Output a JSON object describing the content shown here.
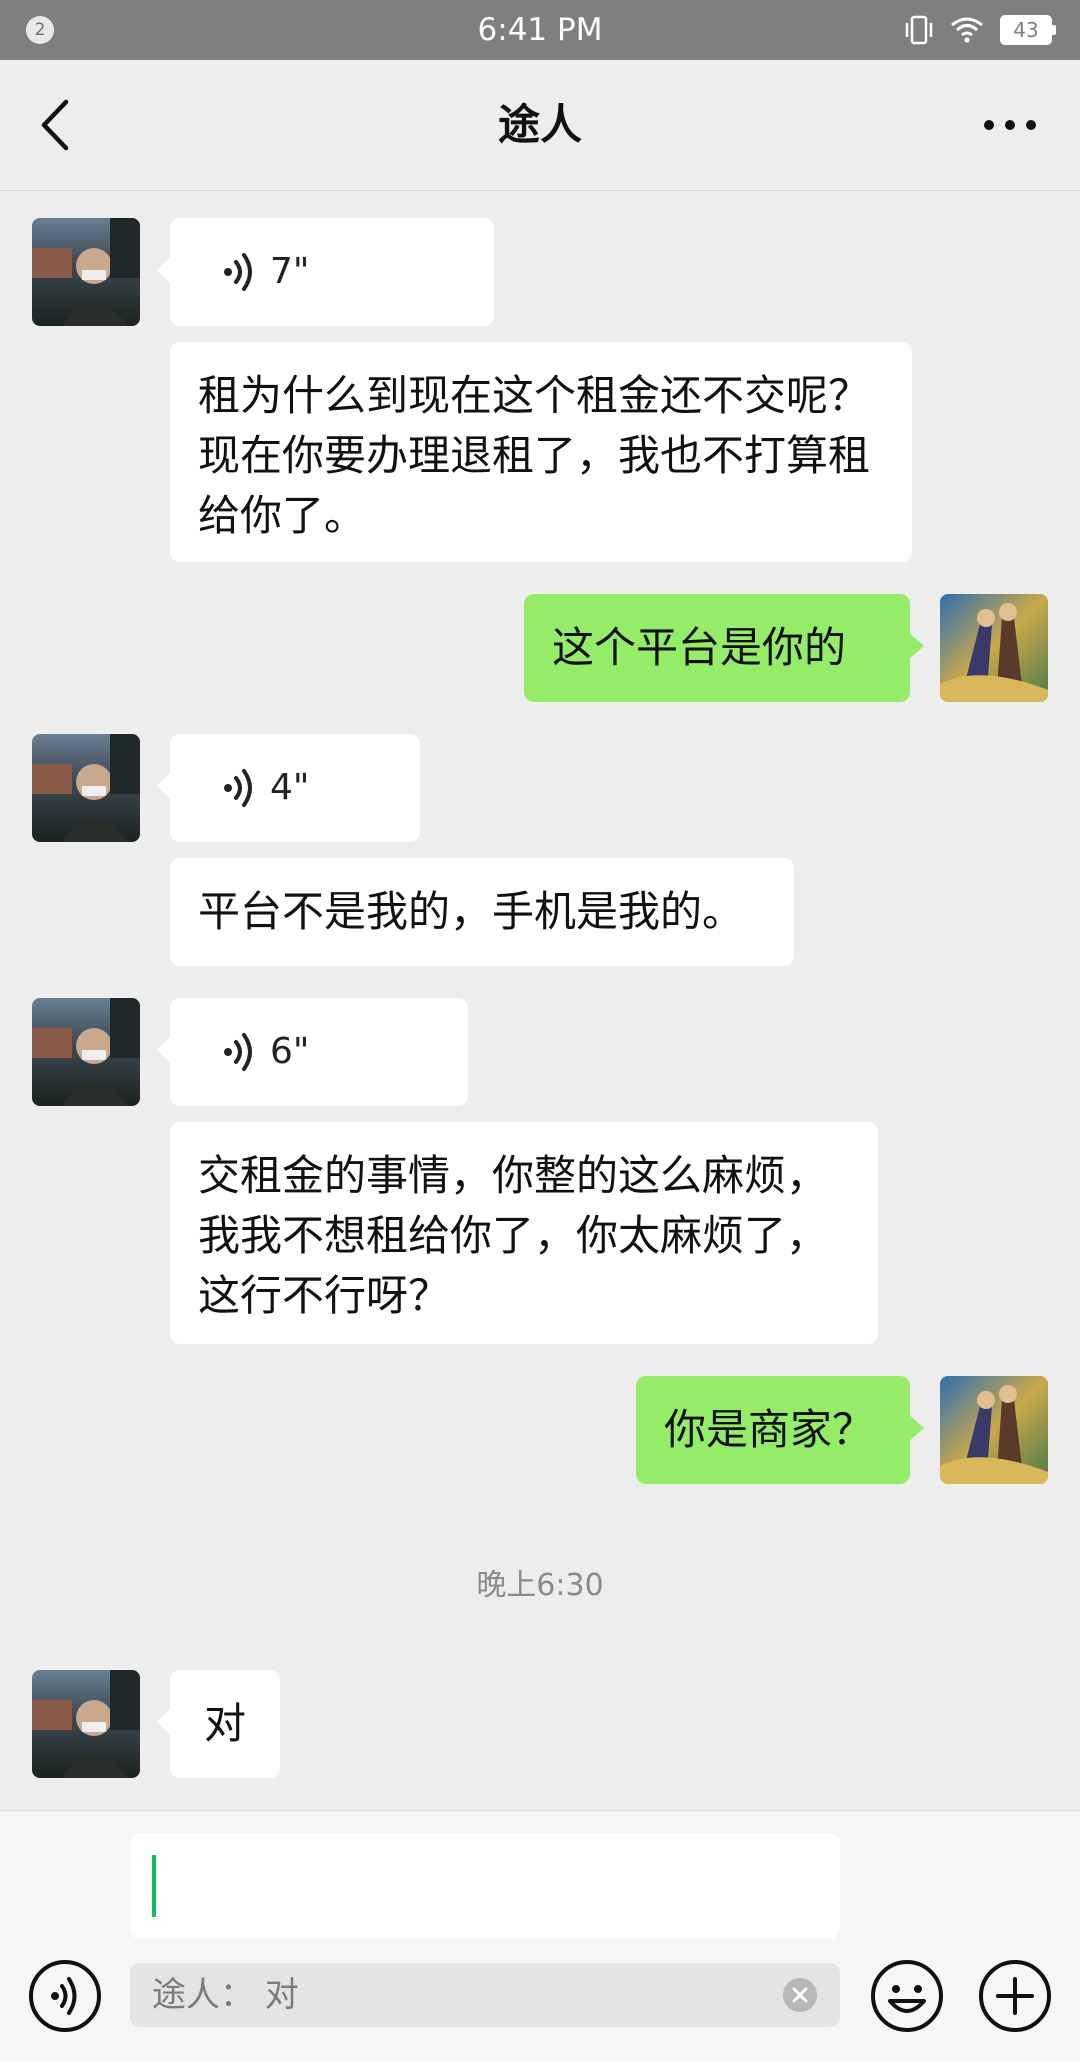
{
  "status_bar": {
    "notification_count": "2",
    "time": "6:41 PM",
    "battery": "43"
  },
  "header": {
    "title": "途人"
  },
  "messages": [
    {
      "side": "left",
      "type": "voice",
      "duration": "7\""
    },
    {
      "side": "left",
      "type": "text",
      "text": "租为什么到现在这个租金还不交呢？现在你要办理退租了，我也不打算租给你了。"
    },
    {
      "side": "right",
      "type": "text",
      "text": "这个平台是你的"
    },
    {
      "side": "left",
      "type": "voice",
      "duration": "4\""
    },
    {
      "side": "left",
      "type": "text",
      "text": "平台不是我的，手机是我的。"
    },
    {
      "side": "left",
      "type": "voice",
      "duration": "6\""
    },
    {
      "side": "left",
      "type": "text",
      "text": "交租金的事情，你整的这么麻烦，我我不想租给你了，你太麻烦了，这行不行呀？"
    },
    {
      "side": "right",
      "type": "text",
      "text": "你是商家？"
    },
    {
      "side": "left",
      "type": "text",
      "text": "对"
    }
  ],
  "timestamp": "晚上6:30",
  "input": {
    "value": "",
    "quote": "途人：  对"
  },
  "icons": {
    "back": "chevron-left-icon",
    "more": "more-dots-icon",
    "voice": "voice-wave-icon",
    "emoji": "smiley-icon",
    "add": "plus-circle-icon",
    "clear": "clear-x-icon"
  },
  "colors": {
    "accent": "#07c160",
    "sent_bubble": "#95ec69",
    "background": "#ededed"
  }
}
